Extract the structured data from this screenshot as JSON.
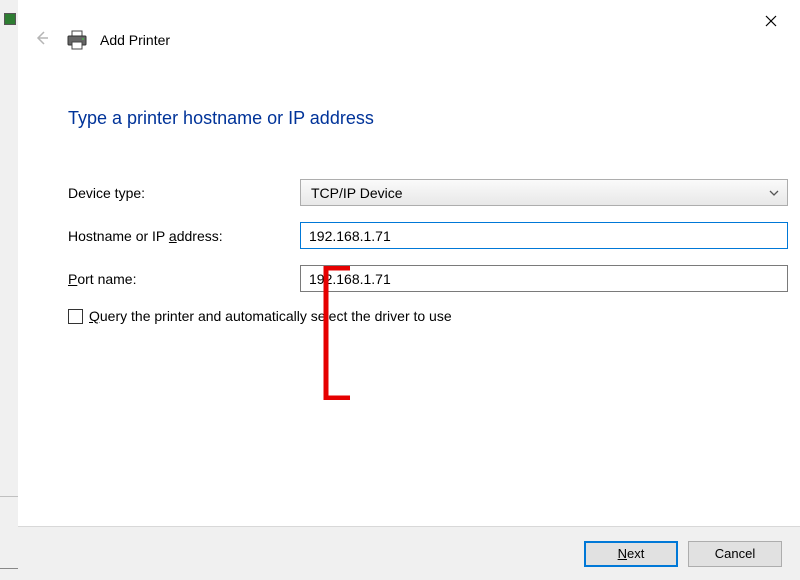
{
  "header": {
    "title": "Add Printer"
  },
  "page": {
    "title": "Type a printer hostname or IP address"
  },
  "form": {
    "device_type_label": "Device type:",
    "device_type_value": "TCP/IP Device",
    "hostname_label_pre": "Hostname or IP ",
    "hostname_label_hotkey": "a",
    "hostname_label_post": "ddress:",
    "hostname_value": "192.168.1.71",
    "port_label_hotkey": "P",
    "port_label_post": "ort name:",
    "port_value": "192.168.1.71",
    "query_label_hotkey": "Q",
    "query_label_post": "uery the printer and automatically select the driver to use",
    "query_checked": false
  },
  "footer": {
    "next_hotkey": "N",
    "next_post": "ext",
    "cancel_label": "Cancel"
  }
}
